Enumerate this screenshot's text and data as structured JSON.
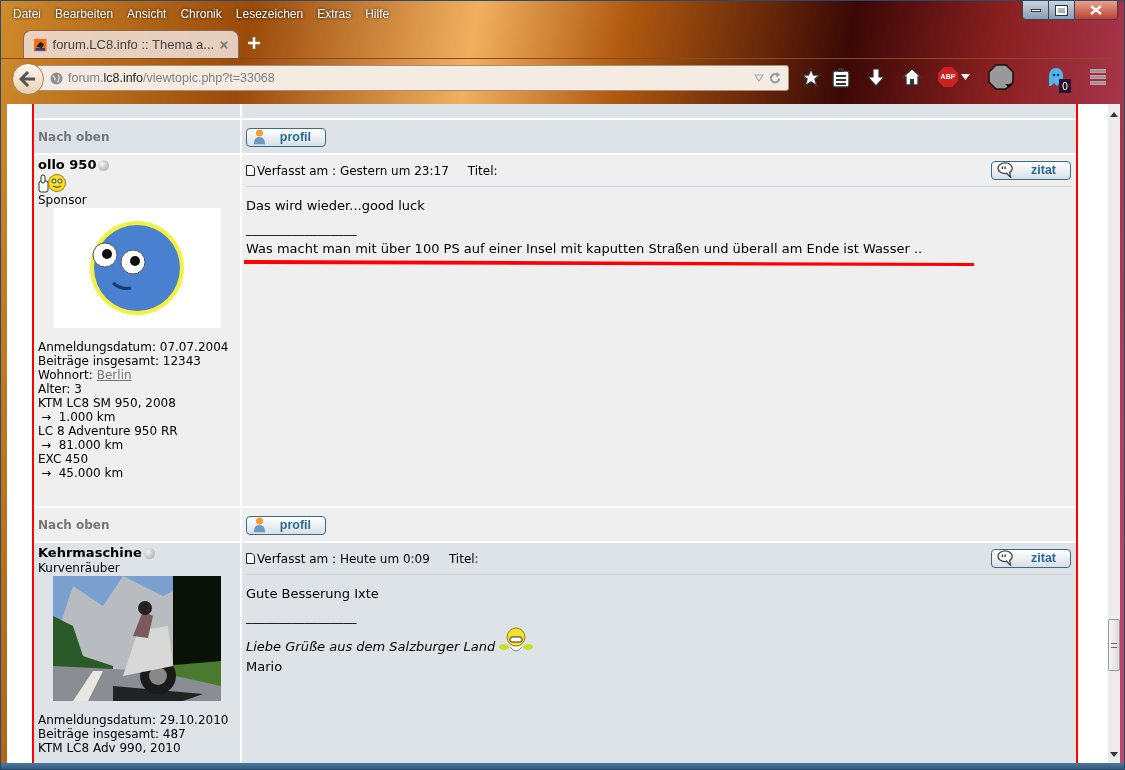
{
  "menu_bar": [
    "Datei",
    "Bearbeiten",
    "Ansicht",
    "Chronik",
    "Lesezeichen",
    "Extras",
    "Hilfe"
  ],
  "tabs": [
    {
      "title": "forum.LC8.info :: Thema a...",
      "selected": true
    }
  ],
  "address_bar": {
    "url_prefix": "forum.",
    "url_domain": "lc8.info",
    "url_suffix": "/viewtopic.php?t=33068"
  },
  "toolbar": {
    "adblock_label": "ABP",
    "ghost_count": "0"
  },
  "forum": {
    "rows": [
      {
        "kind": "spacer"
      },
      {
        "kind": "nav",
        "back_to_top": "Nach oben",
        "profile_button": "profil"
      },
      {
        "kind": "post",
        "author": "ollo 950",
        "online": false,
        "rank_icon": true,
        "rank": "Sponsor",
        "avatar": {
          "kind": "cartoon"
        },
        "posted": "Verfasst am : Gestern um 23:17",
        "title_label": "Titel:",
        "quote_button": "zitat",
        "message": "Das wird wieder...good luck",
        "signature_separator": "_________________",
        "profile": [
          {
            "kind": "text",
            "text": "Anmeldungsdatum: 07.07.2004"
          },
          {
            "kind": "text",
            "text": "Beiträge insgesamt: 12343"
          },
          {
            "kind": "link",
            "label": "Wohnort:",
            "link": "Berlin"
          },
          {
            "kind": "text",
            "text": "Alter: 3"
          },
          {
            "kind": "text",
            "text": "KTM LC8 SM 950, 2008"
          },
          {
            "kind": "mileage",
            "text": "→  1.000 km"
          },
          {
            "kind": "text",
            "text": "LC 8 Adventure 950 RR"
          },
          {
            "kind": "mileage",
            "text": "→  81.000 km"
          },
          {
            "kind": "text",
            "text": "EXC 450"
          },
          {
            "kind": "mileage",
            "text": "→  45.000 km"
          }
        ],
        "signature": [
          {
            "text": "Was macht man mit über 100 PS auf einer Insel mit kaputten Straßen und überall am Ende ist Wasser ..",
            "italic": false,
            "marked": true,
            "smiley": false
          }
        ]
      },
      {
        "kind": "nav",
        "back_to_top": "Nach oben",
        "profile_button": "profil"
      },
      {
        "kind": "post",
        "author": "Kehrmaschine",
        "online": false,
        "rank_icon": false,
        "rank": "Kurvenräuber",
        "avatar": {
          "kind": "picture"
        },
        "posted": "Verfasst am : Heute um 0:09",
        "title_label": "Titel:",
        "quote_button": "zitat",
        "message": "Gute Besserung Ixte",
        "signature_separator": "_________________",
        "profile": [
          {
            "kind": "text",
            "text": "Anmeldungsdatum: 29.10.2010"
          },
          {
            "kind": "text",
            "text": "Beiträge insgesamt: 487"
          },
          {
            "kind": "text",
            "text": "KTM LC8 Adv 990, 2010"
          }
        ],
        "signature": [
          {
            "text": "Liebe Grüße aus dem Salzburger Land",
            "italic": true,
            "marked": false,
            "smiley": true
          },
          {
            "text": "Mario",
            "italic": false,
            "marked": false,
            "smiley": false
          }
        ]
      }
    ]
  }
}
